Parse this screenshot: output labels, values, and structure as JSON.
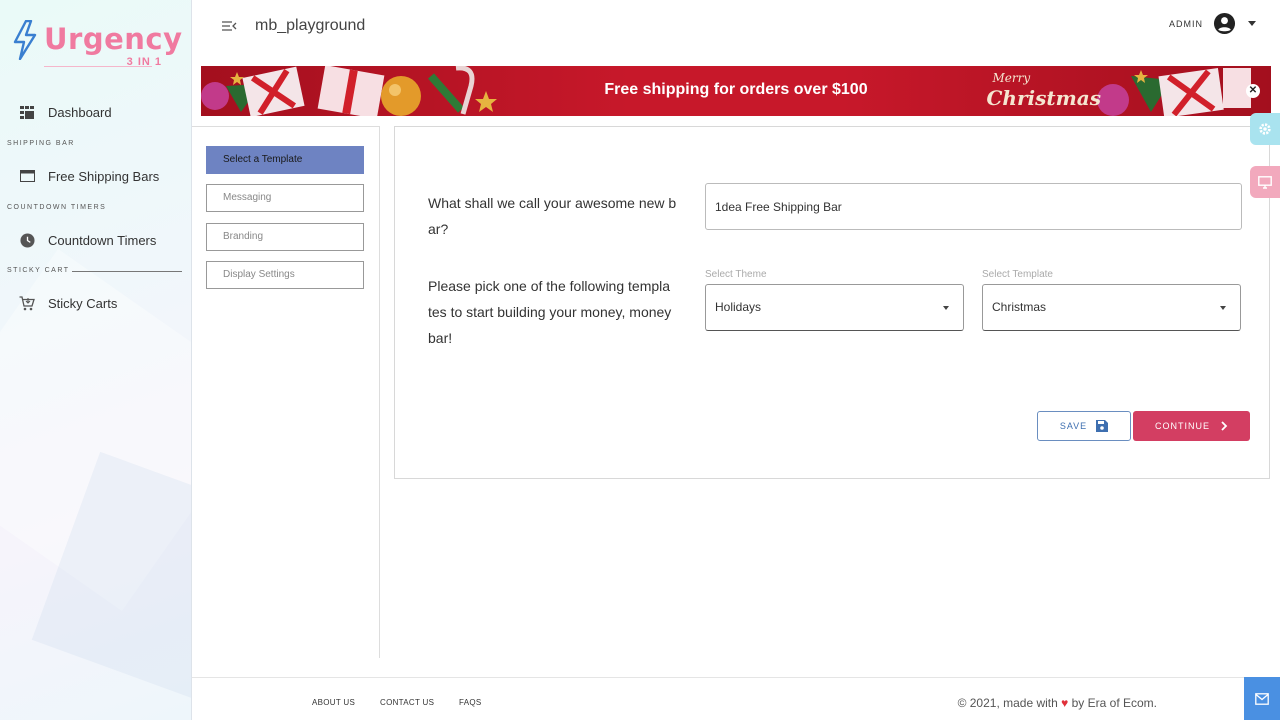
{
  "brand": {
    "name": "Urgency",
    "subtitle": "3 IN 1",
    "color": "#f07aa0"
  },
  "sidebar": {
    "items": [
      {
        "label": "Dashboard",
        "icon": "dashboard-grid-icon"
      },
      {
        "label": "Free Shipping Bars",
        "icon": "bar-window-icon"
      },
      {
        "label": "Countdown Timers",
        "icon": "clock-icon"
      },
      {
        "label": "Sticky Carts",
        "icon": "cart-icon"
      }
    ],
    "sections": [
      "SHIPPING BAR",
      "COUNTDOWN TIMERS",
      "STICKY CART"
    ]
  },
  "header": {
    "store": "mb_playground",
    "user": "ADMIN"
  },
  "banner": {
    "message": "Free shipping for orders over $100",
    "script_top": "Merry",
    "script_bottom": "Christmas"
  },
  "steps": [
    {
      "label": "Select a Template",
      "active": true
    },
    {
      "label": "Messaging",
      "active": false
    },
    {
      "label": "Branding",
      "active": false
    },
    {
      "label": "Display Settings",
      "active": false
    }
  ],
  "form": {
    "name_question_line1": "What shall we call your awesome new b",
    "name_question_line2": "ar?",
    "name_value": "1dea Free Shipping Bar",
    "template_question_line1": "Please pick one of the following templa",
    "template_question_line2": "tes to start building your money, money",
    "template_question_line3": "bar!",
    "theme_label": "Select Theme",
    "theme_value": "Holidays",
    "template_label": "Select Template",
    "template_value": "Christmas",
    "save_label": "SAVE",
    "continue_label": "CONTINUE"
  },
  "footer": {
    "about": "ABOUT US",
    "contact": "CONTACT US",
    "faqs": "FAQS",
    "copy_prefix": "© 2021, made with",
    "copy_suffix": "by Era of Ecom."
  },
  "colors": {
    "accent": "#d33e62",
    "step_active": "#6e83c2",
    "banner": "#c7182a",
    "save": "#3e6fb0"
  }
}
